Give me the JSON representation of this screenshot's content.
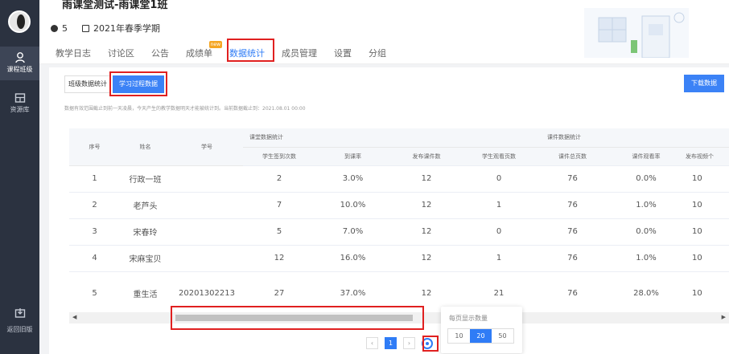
{
  "sidebar": {
    "items": [
      {
        "label": "课程班级",
        "icon": "class-icon"
      },
      {
        "label": "资源库",
        "icon": "library-icon"
      },
      {
        "label": "返回旧版",
        "icon": "return-icon"
      }
    ]
  },
  "header": {
    "course_title": "雨课堂测试-雨课堂1班",
    "member_count": "5",
    "semester": "2021年春季学期"
  },
  "tabs": [
    {
      "label": "教学日志"
    },
    {
      "label": "讨论区"
    },
    {
      "label": "公告"
    },
    {
      "label": "成绩单",
      "badge": "new"
    },
    {
      "label": "数据统计"
    },
    {
      "label": "成员管理"
    },
    {
      "label": "设置"
    },
    {
      "label": "分组"
    }
  ],
  "toolbar": {
    "class_stats_label": "班级数据统计",
    "learning_process_label": "学习过程数据",
    "download_label": "下载数据",
    "note": "数据有效范围截止到前一天凌晨，今天产生的教学数据明天才能被统计到。当前数据截止到：2021.08.01 00:00"
  },
  "table": {
    "headers": {
      "index": "序号",
      "name": "姓名",
      "student_id": "学号",
      "group_classroom": "课堂数据统计",
      "group_courseware": "课件数据统计",
      "sub": [
        "学生签到次数",
        "到课率",
        "发布课件数",
        "学生观看页数",
        "课件总页数",
        "课件观看率",
        "发布视频个"
      ]
    },
    "rows": [
      [
        "1",
        "行政一班",
        "",
        "2",
        "3.0%",
        "12",
        "0",
        "76",
        "0.0%",
        "10"
      ],
      [
        "2",
        "老芦头",
        "",
        "7",
        "10.0%",
        "12",
        "1",
        "76",
        "1.0%",
        "10"
      ],
      [
        "3",
        "宋春玲",
        "",
        "5",
        "7.0%",
        "12",
        "0",
        "76",
        "0.0%",
        "10"
      ],
      [
        "4",
        "宋麻宝贝",
        "",
        "12",
        "16.0%",
        "12",
        "1",
        "76",
        "1.0%",
        "10"
      ],
      [
        "5",
        "重生活",
        "20201302213",
        "27",
        "37.0%",
        "12",
        "21",
        "76",
        "28.0%",
        "10"
      ]
    ]
  },
  "pagination": {
    "current_page": "1",
    "prev": "‹",
    "next": "›",
    "page_size_title": "每页显示数量",
    "page_sizes": [
      "10",
      "20",
      "50"
    ],
    "selected_size": "20"
  }
}
